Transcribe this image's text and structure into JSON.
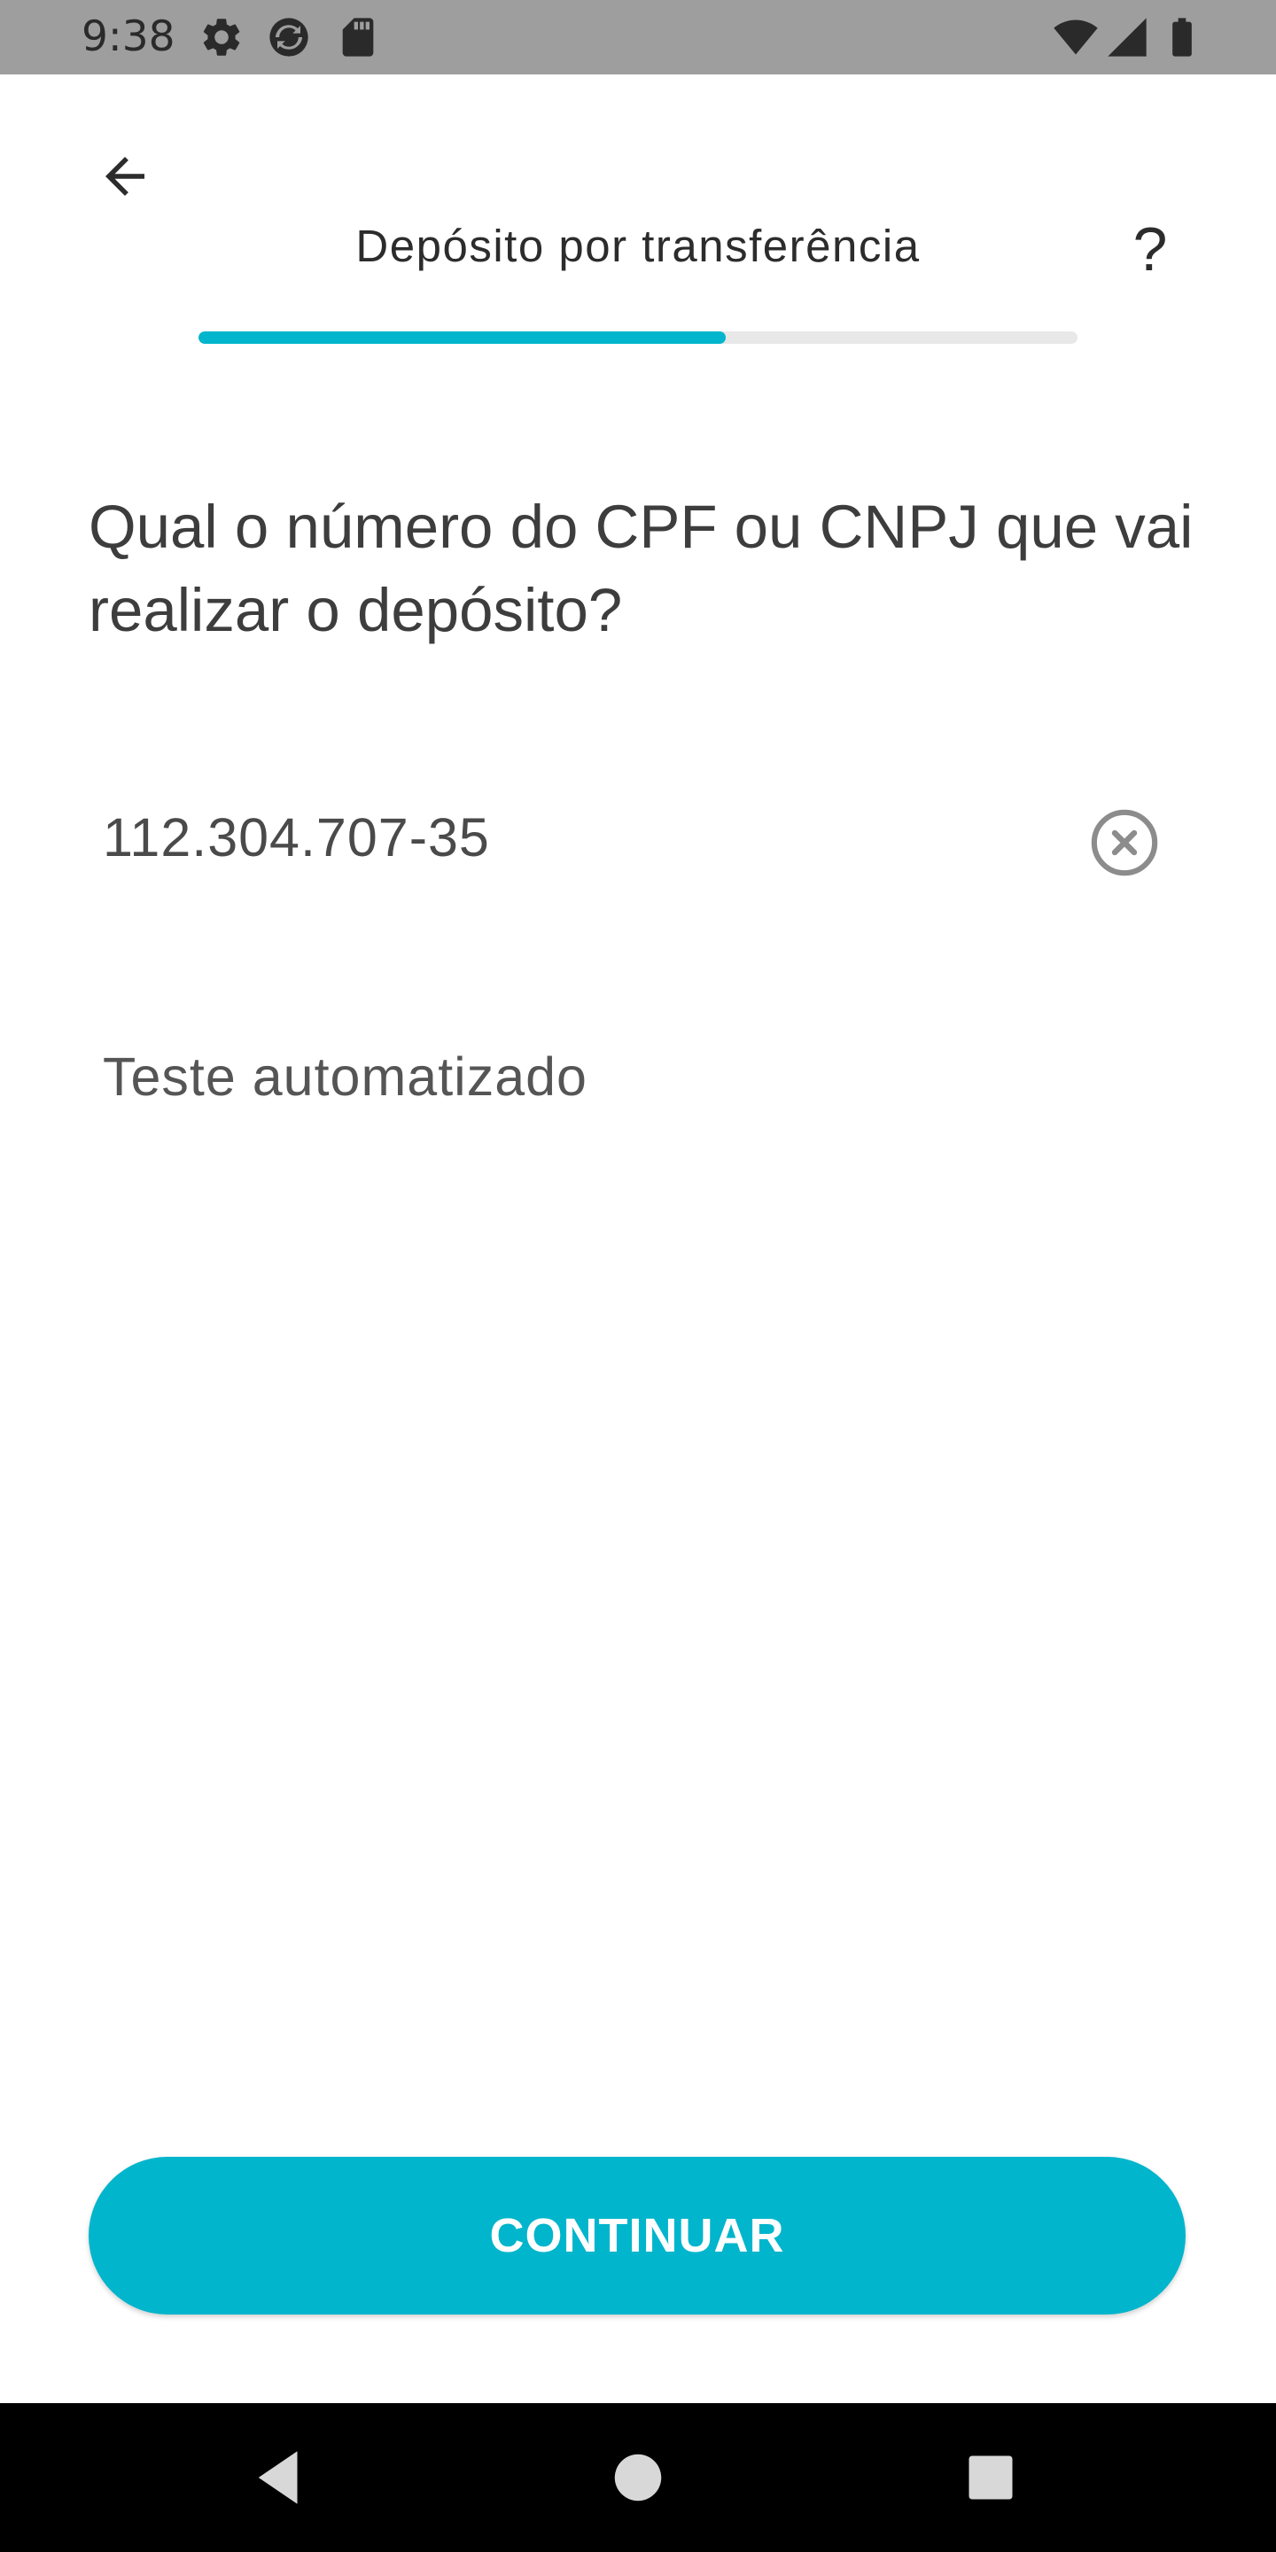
{
  "status_bar": {
    "time": "9:38",
    "left_icons": [
      "gear-icon",
      "sync-icon",
      "sd-card-icon"
    ],
    "right_icons": [
      "wifi-icon",
      "signal-icon",
      "battery-icon"
    ]
  },
  "header": {
    "back_icon": "arrow-left-icon",
    "title": "Depósito por transferência",
    "help_label": "?",
    "progress_fraction": 0.6
  },
  "question": {
    "text": "Qual o número do CPF ou CNPJ que vai realizar o depósito?"
  },
  "fields": {
    "cpf": {
      "value": "112.304.707-35",
      "clear_icon": "clear-circle-icon"
    },
    "name": {
      "value": "Teste automatizado"
    }
  },
  "actions": {
    "continue_label": "CONTINUAR"
  },
  "colors": {
    "accent": "#00b5cc",
    "status_bar": "#9e9e9e",
    "nav_bar": "#000000",
    "track": "#e8e8e8"
  },
  "nav_bar": {
    "icons": [
      "nav-back-icon",
      "nav-home-icon",
      "nav-recents-icon"
    ]
  }
}
